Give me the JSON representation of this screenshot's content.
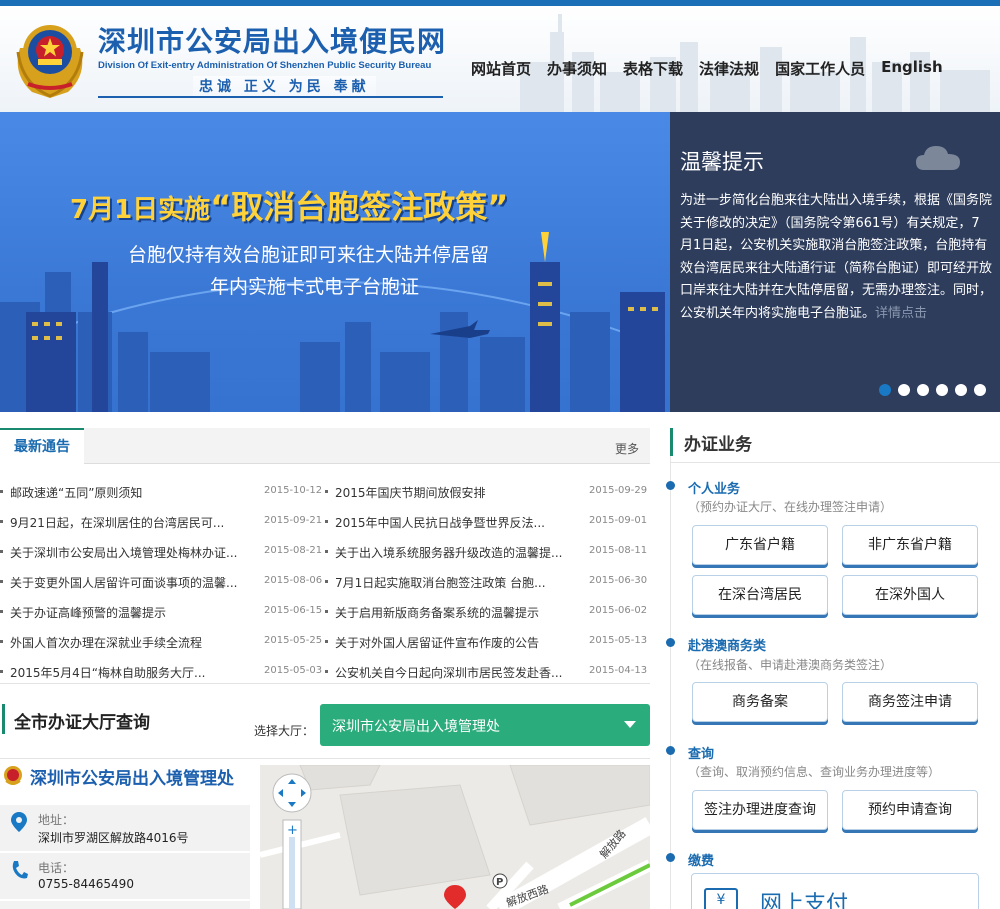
{
  "header": {
    "title": "深圳市公安局出入境便民网",
    "subtitle": "Division Of Exit-entry Administration Of Shenzhen Public Security Bureau",
    "motto": "忠诚  正义  为民  奉献",
    "nav": [
      "网站首页",
      "办事须知",
      "表格下载",
      "法律法规",
      "国家工作人员",
      "English"
    ]
  },
  "banner": {
    "headline_prefix": "7月1日实施",
    "headline": "“取消台胞签注政策”",
    "line1": "台胞仅持有效台胞证即可来往大陆并停居留",
    "line2": "年内实施卡式电子台胞证"
  },
  "notice": {
    "title": "温馨提示",
    "text": "为进一步简化台胞来往大陆出入境手续，根据《国务院关于修改的决定》（国务院令第661号）有关规定，7月1日起，公安机关实施取消台胞签注政策，台胞持有效台湾居民来往大陆通行证（简称台胞证）即可经开放口岸来往大陆并在大陆停居留，无需办理签注。同时，公安机关年内将实施电子台胞证。",
    "more": "详情点击",
    "slide_count": 6,
    "active_slide": 1
  },
  "news": {
    "tab": "最新通告",
    "more": "更多",
    "left": [
      {
        "title": "邮政速递“五同”原则须知",
        "date": "2015-10-12"
      },
      {
        "title": "9月21日起，在深圳居住的台湾居民可...",
        "date": "2015-09-21"
      },
      {
        "title": "关于深圳市公安局出入境管理处梅林办证...",
        "date": "2015-08-21"
      },
      {
        "title": "关于变更外国人居留许可面谈事项的温馨...",
        "date": "2015-08-06"
      },
      {
        "title": "关于办证高峰预警的温馨提示",
        "date": "2015-06-15"
      },
      {
        "title": "外国人首次办理在深就业手续全流程",
        "date": "2015-05-25"
      },
      {
        "title": "2015年5月4日“梅林自助服务大厅...",
        "date": "2015-05-03"
      }
    ],
    "right": [
      {
        "title": "2015年国庆节期间放假安排",
        "date": "2015-09-29"
      },
      {
        "title": "2015年中国人民抗日战争暨世界反法...",
        "date": "2015-09-01"
      },
      {
        "title": "关于出入境系统服务器升级改造的温馨提...",
        "date": "2015-08-11"
      },
      {
        "title": "7月1日起实施取消台胞签注政策 台胞...",
        "date": "2015-06-30"
      },
      {
        "title": "关于启用新版商务备案系统的温馨提示",
        "date": "2015-06-02"
      },
      {
        "title": "关于对外国人居留证件宣布作废的公告",
        "date": "2015-05-13"
      },
      {
        "title": "公安机关自今日起向深圳市居民签发赴香...",
        "date": "2015-04-13"
      }
    ]
  },
  "hall": {
    "title": "全市办证大厅查询",
    "select_label": "选择大厅：",
    "selected": "深圳市公安局出入境管理处",
    "office_name": "深圳市公安局出入境管理处",
    "address_label": "地址：",
    "address": "深圳市罗湖区解放路4016号",
    "phone_label": "电话：",
    "phone": "0755-84465490",
    "map_roads": [
      "解放路",
      "解放西路"
    ]
  },
  "business": {
    "title": "办证业务",
    "sections": [
      {
        "title": "个人业务",
        "sub": "（预约办证大厅、在线办理签注申请）",
        "buttons": [
          "广东省户籍",
          "非广东省户籍",
          "在深台湾居民",
          "在深外国人"
        ]
      },
      {
        "title": "赴港澳商务类",
        "sub": "（在线报备、申请赴港澳商务类签注）",
        "buttons": [
          "商务备案",
          "商务签注申请"
        ]
      },
      {
        "title": "查询",
        "sub": "（查询、取消预约信息、查询业务办理进度等）",
        "buttons": [
          "签注办理进度查询",
          "预约申请查询"
        ]
      },
      {
        "title": "缴费",
        "pay_label": "网上支付"
      }
    ]
  },
  "colors": {
    "brand_blue": "#1b5fae",
    "accent_green": "#2bac7c",
    "notice_bg": "#2e3d5c",
    "banner_blue": "#3b78d6",
    "headline_yellow": "#ffd23a"
  }
}
